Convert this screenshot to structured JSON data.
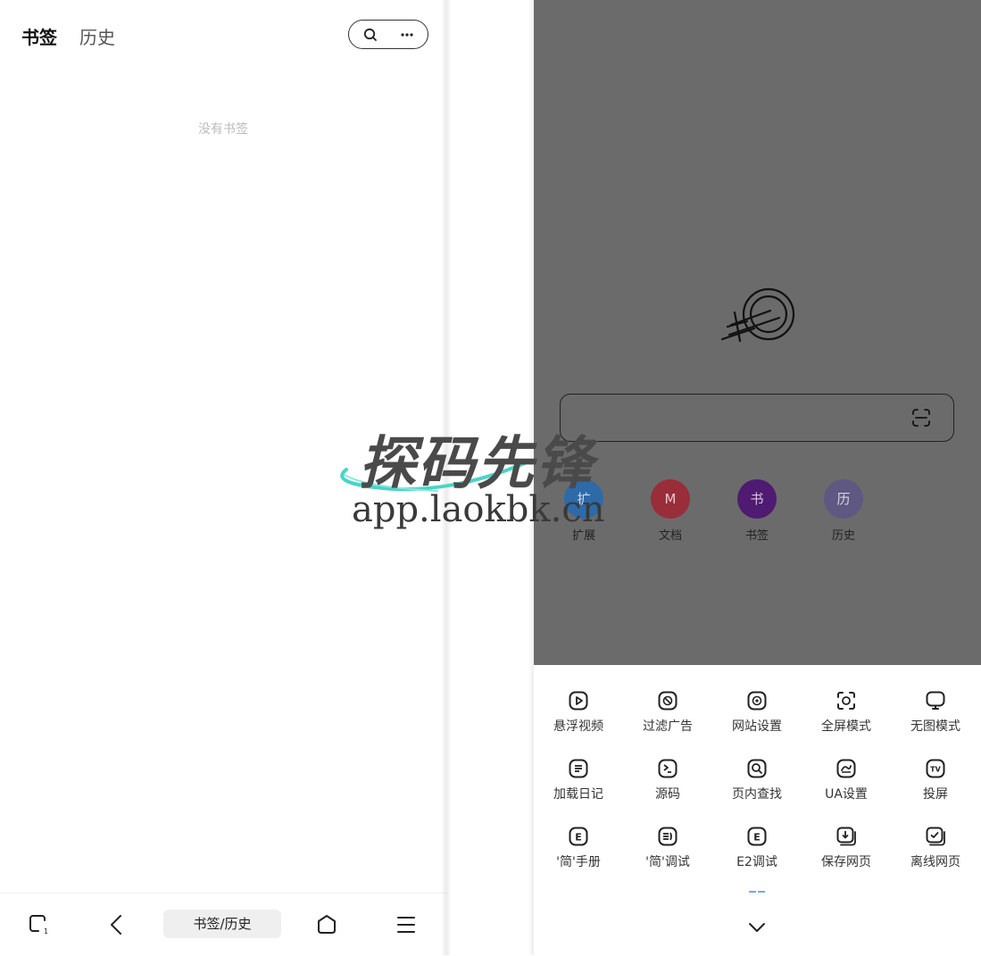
{
  "left_panel": {
    "tabs": [
      "书签",
      "历史"
    ],
    "empty_text": "没有书签",
    "bottom_bar": {
      "center_label": "书签/历史"
    }
  },
  "right_panel": {
    "quick_access": [
      {
        "label": "扩展",
        "glyph": "扩",
        "color": "#2e6aa8"
      },
      {
        "label": "文档",
        "glyph": "M",
        "color": "#9a2d3a"
      },
      {
        "label": "书签",
        "glyph": "书",
        "color": "#4f1a72"
      },
      {
        "label": "历史",
        "glyph": "历",
        "color": "#5e5882"
      }
    ],
    "menu": [
      {
        "label": "悬浮视频",
        "icon": "play-icon"
      },
      {
        "label": "过滤广告",
        "icon": "block-icon"
      },
      {
        "label": "网站设置",
        "icon": "site-settings-icon"
      },
      {
        "label": "全屏模式",
        "icon": "fullscreen-icon"
      },
      {
        "label": "无图模式",
        "icon": "no-image-icon"
      },
      {
        "label": "加载日记",
        "icon": "log-icon"
      },
      {
        "label": "源码",
        "icon": "source-code-icon"
      },
      {
        "label": "页内查找",
        "icon": "find-in-page-icon"
      },
      {
        "label": "UA设置",
        "icon": "ua-icon"
      },
      {
        "label": "投屏",
        "icon": "tv-cast-icon"
      },
      {
        "label": "'简'手册",
        "icon": "manual-icon"
      },
      {
        "label": "'简'调试",
        "icon": "debug-icon"
      },
      {
        "label": "E2调试",
        "icon": "e2-debug-icon"
      },
      {
        "label": "保存网页",
        "icon": "save-page-icon"
      },
      {
        "label": "离线网页",
        "icon": "offline-page-icon"
      }
    ]
  },
  "watermark": {
    "title": "探码先锋",
    "url": "app.laokbk.cn"
  }
}
